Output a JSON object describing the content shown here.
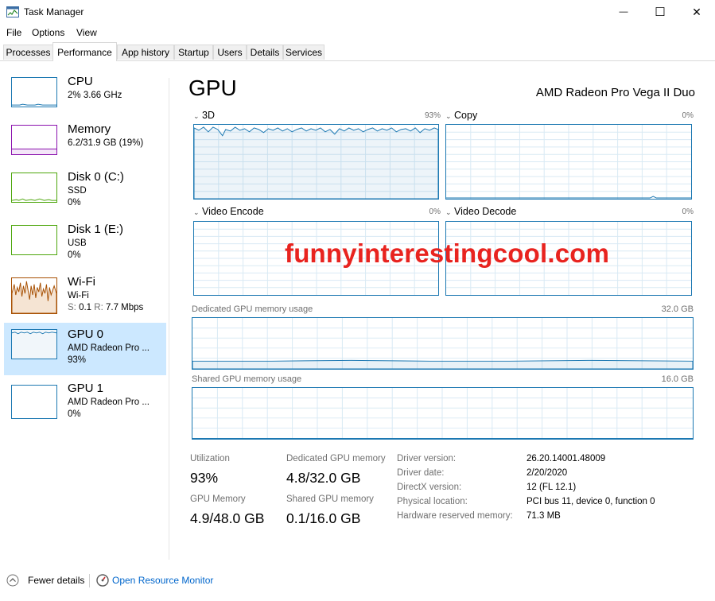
{
  "window": {
    "title": "Task Manager",
    "controls": {
      "minimize": "—",
      "maximize": "☐",
      "close": "✕"
    }
  },
  "menu": {
    "items": [
      "File",
      "Options",
      "View"
    ]
  },
  "tabs": [
    {
      "label": "Processes"
    },
    {
      "label": "Performance",
      "active": true
    },
    {
      "label": "App history"
    },
    {
      "label": "Startup"
    },
    {
      "label": "Users"
    },
    {
      "label": "Details"
    },
    {
      "label": "Services"
    }
  ],
  "sidebar": {
    "items": [
      {
        "title": "CPU",
        "line1": "2% 3.66 GHz",
        "line2": "",
        "color": "#1c78b2"
      },
      {
        "title": "Memory",
        "line1": "6.2/31.9 GB (19%)",
        "line2": "",
        "color": "#8b12ae"
      },
      {
        "title": "Disk 0 (C:)",
        "line1": "SSD",
        "line2": "0%",
        "color": "#4da60c"
      },
      {
        "title": "Disk 1 (E:)",
        "line1": "USB",
        "line2": "0%",
        "color": "#4da60c"
      },
      {
        "title": "Wi-Fi",
        "line1": "Wi-Fi",
        "line2_prefix_s": "S:",
        "line2_s": "0.1",
        "line2_prefix_r": "R:",
        "line2_r": "7.7 Mbps",
        "color": "#a74f01"
      },
      {
        "title": "GPU 0",
        "line1": "AMD Radeon Pro ...",
        "line2": "93%",
        "color": "#1c78b2",
        "selected": true
      },
      {
        "title": "GPU 1",
        "line1": "AMD Radeon Pro ...",
        "line2": "0%",
        "color": "#1c78b2"
      }
    ]
  },
  "main": {
    "heading": "GPU",
    "device_name": "AMD Radeon Pro Vega II Duo",
    "engines": [
      {
        "label": "3D",
        "value": "93%"
      },
      {
        "label": "Copy",
        "value": "0%"
      },
      {
        "label": "Video Encode",
        "value": "0%"
      },
      {
        "label": "Video Decode",
        "value": "0%"
      }
    ],
    "dedicated_graph": {
      "label": "Dedicated GPU memory usage",
      "max": "32.0 GB"
    },
    "shared_graph": {
      "label": "Shared GPU memory usage",
      "max": "16.0 GB"
    },
    "stats": {
      "utilization_label": "Utilization",
      "utilization": "93%",
      "dedicated_label": "Dedicated GPU memory",
      "dedicated": "4.8/32.0 GB",
      "gpu_memory_label": "GPU Memory",
      "gpu_memory": "4.9/48.0 GB",
      "shared_label": "Shared GPU memory",
      "shared": "0.1/16.0 GB"
    },
    "info": [
      {
        "label": "Driver version:",
        "value": "26.20.14001.48009"
      },
      {
        "label": "Driver date:",
        "value": "2/20/2020"
      },
      {
        "label": "DirectX version:",
        "value": "12 (FL 12.1)"
      },
      {
        "label": "Physical location:",
        "value": "PCI bus 11, device 0, function 0"
      },
      {
        "label": "Hardware reserved memory:",
        "value": "71.3 MB"
      }
    ]
  },
  "watermark": "funnyinterestingcool.com",
  "footer": {
    "fewer_details": "Fewer details",
    "open_resource_monitor": "Open Resource Monitor"
  }
}
